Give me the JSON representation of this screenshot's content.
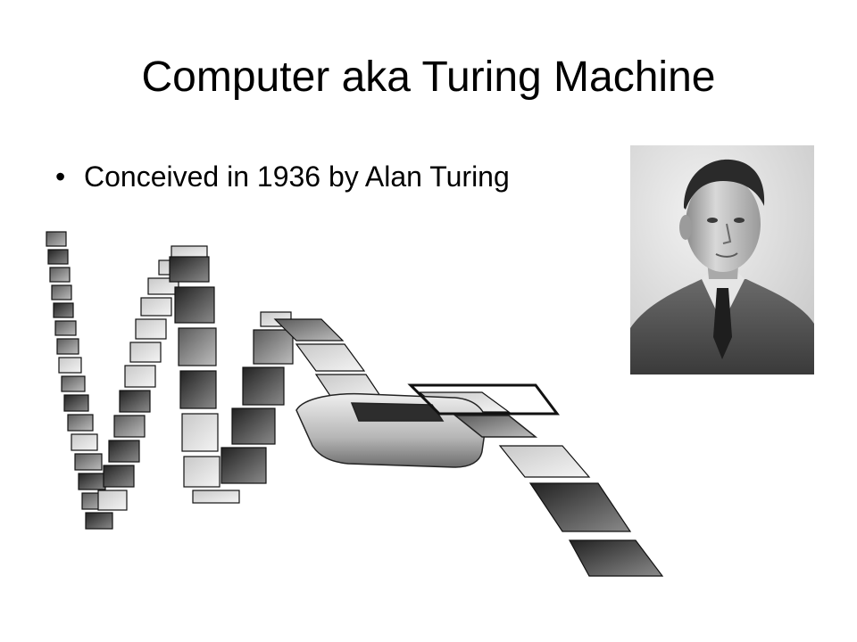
{
  "slide": {
    "title": "Computer aka Turing Machine",
    "bullets": [
      {
        "text": "Conceived in 1936 by Alan Turing"
      }
    ],
    "bullet_glyph": "•"
  },
  "images": {
    "portrait": {
      "subject": "alan-turing-portrait",
      "style": "grayscale-photo"
    },
    "illustration": {
      "subject": "turing-machine-tape-and-head",
      "style": "grayscale-3d-illustration"
    }
  },
  "colors": {
    "background": "#ffffff",
    "text": "#000000"
  }
}
